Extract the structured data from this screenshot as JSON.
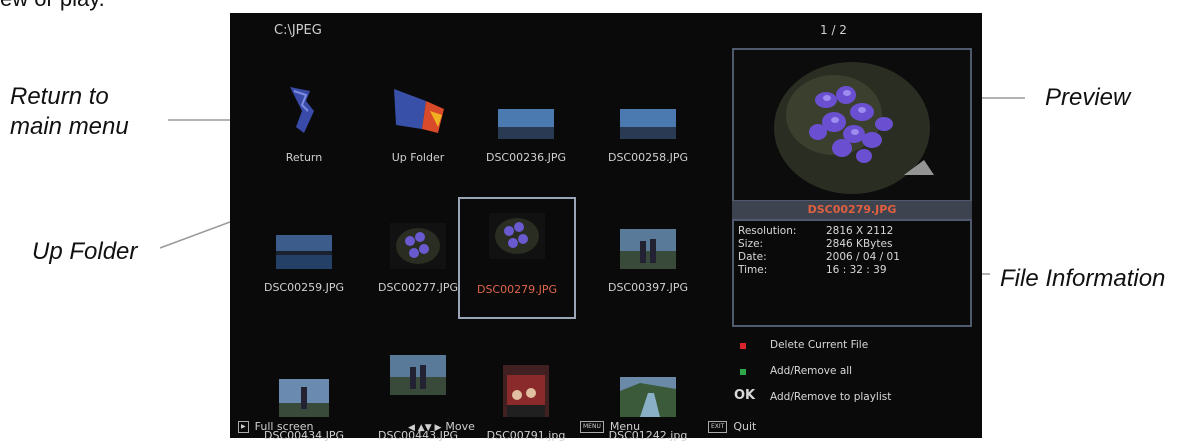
{
  "top_fragment": "ew or play.",
  "callouts": {
    "return": "Return to\nmain menu",
    "up_folder": "Up Folder",
    "preview": "Preview",
    "file_info": "File Information"
  },
  "screen": {
    "path": "C:\\JPEG",
    "page": "1 / 2",
    "thumbs": [
      {
        "label": "Return",
        "icon": "return-arrow-icon"
      },
      {
        "label": "Up Folder",
        "icon": "up-folder-icon"
      },
      {
        "label": "DSC00236.JPG",
        "icon": "landscape-thumbnail"
      },
      {
        "label": "DSC00258.JPG",
        "icon": "landscape-thumbnail"
      },
      {
        "label": "DSC00259.JPG",
        "icon": "lake-thumbnail"
      },
      {
        "label": "DSC00277.JPG",
        "icon": "flower-thumbnail"
      },
      {
        "label": "DSC00279.JPG",
        "icon": "flower-thumbnail"
      },
      {
        "label": "DSC00397.JPG",
        "icon": "people-thumbnail"
      },
      {
        "label": "DSC00434.JPG",
        "icon": "person-thumbnail"
      },
      {
        "label": "DSC00443.JPG",
        "icon": "people-thumbnail"
      },
      {
        "label": "DSC00791.jpg",
        "icon": "group-thumbnail"
      },
      {
        "label": "DSC01242.jpg",
        "icon": "river-thumbnail"
      }
    ],
    "selected_file": "DSC00279.JPG",
    "info": {
      "resolution_label": "Resolution:",
      "resolution": "2816 X 2112",
      "size_label": "Size:",
      "size": "2846 KBytes",
      "date_label": "Date:",
      "date": "2006 / 04 / 01",
      "time_label": "Time:",
      "time": "16 : 32 : 39"
    },
    "legend": {
      "delete": "Delete Current File",
      "add_remove_all": "Add/Remove all",
      "ok_key": "OK",
      "add_remove_playlist": "Add/Remove to playlist"
    },
    "bottom": {
      "full_screen": "Full screen",
      "move": "Move",
      "menu_key": "MENU",
      "menu": "Menu",
      "exit_key": "EXIT",
      "quit": "Quit"
    },
    "colors": {
      "red_button": "#d8242a",
      "green_button": "#2ea84a",
      "selected_text": "#e0664a"
    }
  }
}
